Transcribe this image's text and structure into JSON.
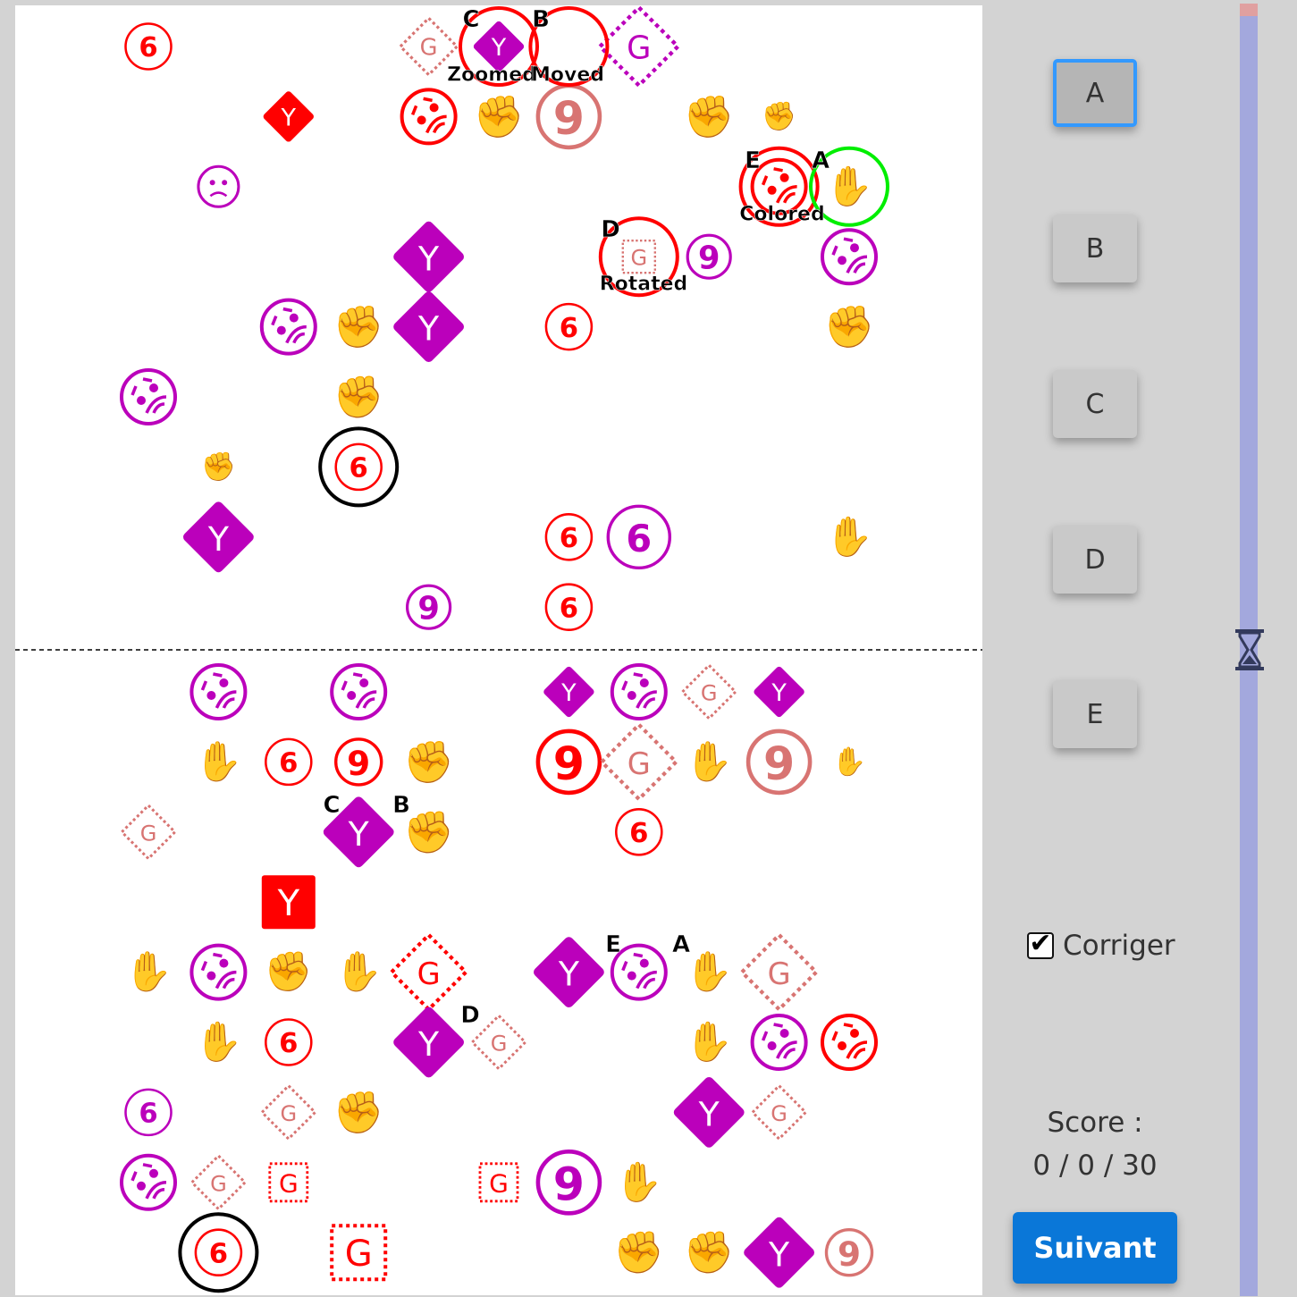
{
  "colors": {
    "red": "#ff0000",
    "magenta": "#bb00bb",
    "salmon": "#d87472",
    "correct": "#00ee00",
    "marker": "#000000"
  },
  "board": {
    "top_items": [
      {
        "kind": "spiral6",
        "color": "red"
      },
      {
        "kind": "g-diamond",
        "color": "salmon"
      },
      {
        "kind": "y-diamond",
        "color": "magenta"
      },
      {
        "kind": "g-diamond",
        "color": "magenta"
      },
      {
        "kind": "y-diamond",
        "color": "red"
      },
      {
        "kind": "face",
        "color": "red"
      },
      {
        "kind": "fist",
        "color": "red"
      },
      {
        "kind": "nine",
        "color": "salmon"
      },
      {
        "kind": "fist",
        "color": "red"
      },
      {
        "kind": "fist",
        "color": "magenta"
      },
      {
        "kind": "sad",
        "color": "magenta"
      },
      {
        "kind": "face",
        "color": "red"
      },
      {
        "kind": "hand",
        "color": "magenta"
      },
      {
        "kind": "y-diamond",
        "color": "magenta"
      },
      {
        "kind": "g-square",
        "color": "salmon"
      },
      {
        "kind": "nine",
        "color": "magenta"
      },
      {
        "kind": "face",
        "color": "magenta"
      },
      {
        "kind": "face",
        "color": "magenta"
      },
      {
        "kind": "fist",
        "color": "red"
      },
      {
        "kind": "y-diamond",
        "color": "magenta"
      },
      {
        "kind": "spiral6",
        "color": "red"
      },
      {
        "kind": "fist",
        "color": "red"
      },
      {
        "kind": "face",
        "color": "magenta"
      },
      {
        "kind": "fist",
        "color": "red"
      },
      {
        "kind": "fist",
        "color": "magenta"
      },
      {
        "kind": "spiral6",
        "color": "red"
      },
      {
        "kind": "y-diamond",
        "color": "magenta"
      },
      {
        "kind": "spiral6",
        "color": "red"
      },
      {
        "kind": "spiral6",
        "color": "magenta"
      },
      {
        "kind": "hand",
        "color": "magenta"
      },
      {
        "kind": "nine",
        "color": "magenta"
      },
      {
        "kind": "spiral6",
        "color": "red"
      }
    ],
    "bottom_items": [
      {
        "kind": "face",
        "color": "magenta"
      },
      {
        "kind": "face",
        "color": "magenta"
      },
      {
        "kind": "y-diamond",
        "color": "magenta"
      },
      {
        "kind": "face",
        "color": "magenta"
      },
      {
        "kind": "g-diamond",
        "color": "salmon"
      },
      {
        "kind": "y-diamond",
        "color": "magenta"
      },
      {
        "kind": "hand",
        "color": "magenta"
      },
      {
        "kind": "spiral6",
        "color": "red"
      },
      {
        "kind": "nine",
        "color": "red"
      },
      {
        "kind": "fist",
        "color": "red"
      },
      {
        "kind": "nine",
        "color": "red"
      },
      {
        "kind": "g-diamond",
        "color": "salmon"
      },
      {
        "kind": "hand",
        "color": "magenta"
      },
      {
        "kind": "nine",
        "color": "salmon"
      },
      {
        "kind": "hand",
        "color": "salmon"
      },
      {
        "kind": "g-diamond",
        "color": "salmon"
      },
      {
        "kind": "y-diamond",
        "color": "magenta"
      },
      {
        "kind": "fist",
        "color": "red"
      },
      {
        "kind": "spiral6",
        "color": "red"
      },
      {
        "kind": "y-square",
        "color": "red"
      },
      {
        "kind": "hand",
        "color": "magenta"
      },
      {
        "kind": "face",
        "color": "magenta"
      },
      {
        "kind": "fist",
        "color": "salmon"
      },
      {
        "kind": "hand",
        "color": "magenta"
      },
      {
        "kind": "g-diamond",
        "color": "red"
      },
      {
        "kind": "y-diamond",
        "color": "magenta"
      },
      {
        "kind": "face",
        "color": "magenta"
      },
      {
        "kind": "hand",
        "color": "magenta"
      },
      {
        "kind": "g-diamond",
        "color": "salmon"
      },
      {
        "kind": "hand",
        "color": "magenta"
      },
      {
        "kind": "spiral6",
        "color": "red"
      },
      {
        "kind": "y-diamond",
        "color": "magenta"
      },
      {
        "kind": "g-diamond",
        "color": "salmon"
      },
      {
        "kind": "hand",
        "color": "magenta"
      },
      {
        "kind": "face",
        "color": "magenta"
      },
      {
        "kind": "face",
        "color": "red"
      },
      {
        "kind": "spiral6",
        "color": "magenta"
      },
      {
        "kind": "g-diamond",
        "color": "salmon"
      },
      {
        "kind": "fist",
        "color": "red"
      },
      {
        "kind": "y-diamond",
        "color": "magenta"
      },
      {
        "kind": "g-diamond",
        "color": "salmon"
      },
      {
        "kind": "face",
        "color": "magenta"
      },
      {
        "kind": "g-diamond",
        "color": "salmon"
      },
      {
        "kind": "g-square",
        "color": "red"
      },
      {
        "kind": "g-square",
        "color": "red"
      },
      {
        "kind": "nine",
        "color": "magenta"
      },
      {
        "kind": "hand",
        "color": "magenta"
      },
      {
        "kind": "spiral6",
        "color": "red"
      },
      {
        "kind": "g-square",
        "color": "red"
      },
      {
        "kind": "fist",
        "color": "red"
      },
      {
        "kind": "fist",
        "color": "red"
      },
      {
        "kind": "y-diamond",
        "color": "magenta"
      },
      {
        "kind": "nine",
        "color": "salmon"
      }
    ],
    "top_letters": [
      "C",
      "B",
      "E",
      "A",
      "D"
    ],
    "top_captions": [
      "Zoomed",
      "Moved",
      "Colored",
      "Rotated"
    ],
    "bottom_letters": [
      "C",
      "B",
      "E",
      "A",
      "D"
    ]
  },
  "sidebar": {
    "answers": [
      {
        "label": "A",
        "selected": true
      },
      {
        "label": "B",
        "selected": false
      },
      {
        "label": "C",
        "selected": false
      },
      {
        "label": "D",
        "selected": false
      },
      {
        "label": "E",
        "selected": false
      }
    ],
    "timer_elapsed_fraction": 0.01,
    "timer_icon": "hourglass-icon",
    "corriger_label": "Corriger",
    "corriger_checked": true,
    "score_label": "Score :",
    "score_value": "0 / 0 / 30",
    "next_label": "Suivant"
  }
}
